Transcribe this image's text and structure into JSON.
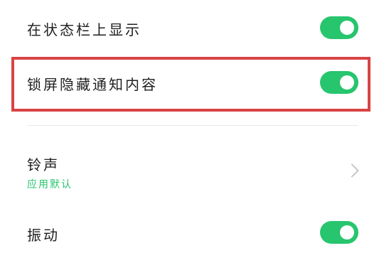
{
  "settings": {
    "status_bar": {
      "label": "在状态栏上显示",
      "enabled": true
    },
    "lock_screen_hide": {
      "label": "锁屏隐藏通知内容",
      "enabled": true
    },
    "ringtone": {
      "label": "铃声",
      "value": "应用默认"
    },
    "vibration": {
      "label": "振动",
      "enabled": true
    }
  },
  "colors": {
    "accent": "#27c56d",
    "highlight": "#d94344",
    "divider": "#e9e9e9",
    "chevron": "#c6c6c6"
  },
  "icons": {
    "ringtone_arrow": "chevron-right-icon"
  }
}
